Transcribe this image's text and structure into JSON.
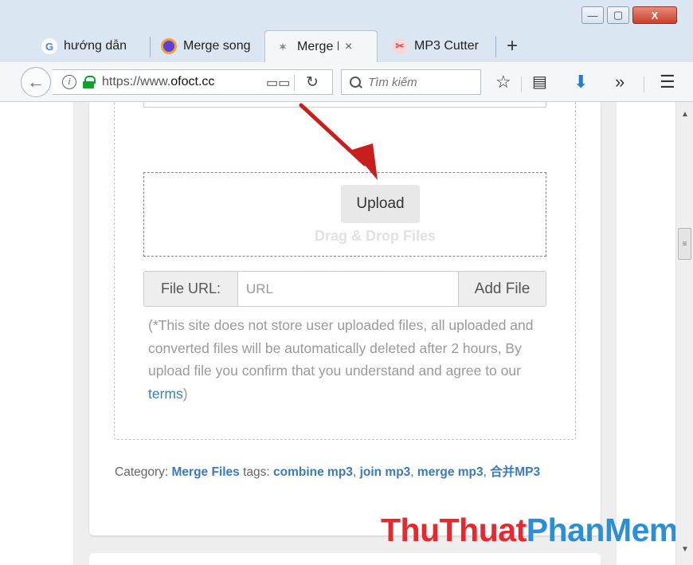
{
  "window": {
    "minimize_icon": "minimize-icon",
    "maximize_icon": "maximize-icon",
    "close_icon": "close-icon",
    "close_label": "X"
  },
  "tabs": [
    {
      "label": "hướng dẫn",
      "icon": "google-icon",
      "icon_char": "G",
      "icon_color": "#4285f4"
    },
    {
      "label": "Merge song",
      "icon": "purple-circle-icon",
      "icon_char": "",
      "icon_color": "#5b3fd6"
    },
    {
      "label": "Merge N",
      "icon": "fox-icon",
      "icon_char": "🐺",
      "icon_color": "#888888",
      "active": true
    },
    {
      "label": "MP3 Cutter",
      "icon": "scissors-icon",
      "icon_char": "✂",
      "icon_color": "#e34a4a"
    }
  ],
  "tab_close": "×",
  "new_tab": "+",
  "navbar": {
    "url_prefix": "https://www.",
    "url_domain": "ofoct.cc",
    "search_placeholder": "Tìm kiếm",
    "reader_icon": "📖",
    "reload_icon": "C",
    "star_icon": "☆",
    "bookmarks_icon": "▤",
    "download_icon": "⬇",
    "overflow_icon": "»",
    "menu_icon": "☰"
  },
  "upload": {
    "upload_label": "Upload",
    "drop_label": "Drag & Drop Files",
    "file_url_label": "File URL:",
    "url_placeholder": "URL",
    "add_file_label": "Add File"
  },
  "note": {
    "text": "(*This site does not store user uploaded files, all uploaded and converted files will be automatically deleted after 2 hours, By upload file you confirm that you understand and agree to our ",
    "link": "terms",
    "end": ")"
  },
  "category": {
    "prefix": "Category: ",
    "category_link": "Merge Files",
    "tags_label": " tags: ",
    "tags": [
      "combine mp3",
      "join mp3",
      "merge mp3",
      "合并MP3"
    ]
  },
  "watermark": {
    "part1": "ThuThuat",
    "part2": "PhanMem.vn"
  },
  "colors": {
    "link": "#3d7ab8",
    "arrow": "#c81e1e",
    "watermark_red": "#e8282e",
    "watermark_blue": "#2c8fd6"
  }
}
